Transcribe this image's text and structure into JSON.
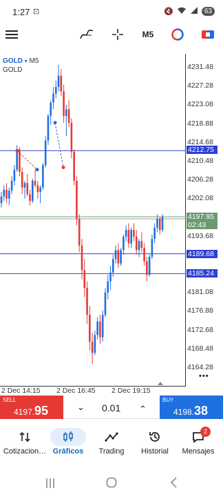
{
  "status": {
    "time": "1:27",
    "battery": "63"
  },
  "toolbar": {
    "timeframe": "M5"
  },
  "chart": {
    "symbol": "GOLD",
    "timeframe": "M5",
    "description": "GOLD",
    "price_ticks": [
      "4231.48",
      "4227.28",
      "4223.08",
      "4218.88",
      "4214.68",
      "4210.48",
      "4206.28",
      "4202.08",
      "4193.68",
      "4181.08",
      "4176.88",
      "4172.68",
      "4168.48",
      "4164.28"
    ],
    "levels": [
      {
        "price": "4212.75"
      },
      {
        "price": "4189.68"
      },
      {
        "price": "4185.24"
      }
    ],
    "current_price": "4197.95",
    "countdown": "02:43",
    "time_labels": [
      "2 Dec 14:15",
      "2 Dec 16:45",
      "2 Dec 19:15"
    ],
    "more": "•••"
  },
  "chart_data": {
    "type": "candlestick",
    "symbol": "GOLD",
    "timeframe": "M5",
    "ylim": [
      4162,
      4233
    ],
    "x_ticks": [
      "2 Dec 14:15",
      "2 Dec 16:45",
      "2 Dec 19:15"
    ],
    "y_ticks": [
      4231.48,
      4227.28,
      4223.08,
      4218.88,
      4214.68,
      4210.48,
      4206.28,
      4202.08,
      4193.68,
      4181.08,
      4176.88,
      4172.68,
      4168.48,
      4164.28
    ],
    "horizontal_levels": [
      4212.75,
      4189.68,
      4185.24
    ],
    "current_bid": 4197.95,
    "candles": [
      [
        4201.0,
        4203.5,
        4200.0,
        4202.5
      ],
      [
        4202.5,
        4205.0,
        4201.5,
        4204.0
      ],
      [
        4204.0,
        4205.5,
        4201.0,
        4202.0
      ],
      [
        4202.0,
        4204.5,
        4200.5,
        4203.8
      ],
      [
        4203.8,
        4207.0,
        4203.0,
        4206.0
      ],
      [
        4206.0,
        4209.5,
        4205.0,
        4208.5
      ],
      [
        4208.5,
        4214.0,
        4208.0,
        4213.0
      ],
      [
        4213.0,
        4213.5,
        4207.0,
        4208.0
      ],
      [
        4208.0,
        4209.0,
        4203.0,
        4204.5
      ],
      [
        4204.5,
        4206.0,
        4202.0,
        4205.5
      ],
      [
        4205.5,
        4207.5,
        4202.5,
        4203.0
      ],
      [
        4203.0,
        4204.0,
        4200.5,
        4201.5
      ],
      [
        4201.5,
        4206.5,
        4201.0,
        4206.0
      ],
      [
        4206.0,
        4208.5,
        4204.5,
        4205.0
      ],
      [
        4205.0,
        4206.0,
        4202.0,
        4203.5
      ],
      [
        4203.5,
        4205.0,
        4201.0,
        4204.5
      ],
      [
        4204.5,
        4210.0,
        4204.0,
        4209.5
      ],
      [
        4209.5,
        4216.0,
        4209.0,
        4215.0
      ],
      [
        4215.0,
        4221.0,
        4214.0,
        4220.5
      ],
      [
        4220.5,
        4224.0,
        4218.5,
        4223.5
      ],
      [
        4223.5,
        4227.0,
        4222.0,
        4225.5
      ],
      [
        4225.5,
        4228.5,
        4224.5,
        4227.0
      ],
      [
        4227.0,
        4232.0,
        4226.0,
        4229.5
      ],
      [
        4229.5,
        4231.0,
        4225.0,
        4226.0
      ],
      [
        4226.0,
        4227.5,
        4219.0,
        4220.5
      ],
      [
        4220.5,
        4223.0,
        4216.0,
        4222.0
      ],
      [
        4222.0,
        4224.0,
        4218.0,
        4219.0
      ],
      [
        4219.0,
        4220.0,
        4211.0,
        4212.5
      ],
      [
        4212.5,
        4213.0,
        4205.0,
        4206.0
      ],
      [
        4206.0,
        4207.0,
        4196.0,
        4197.5
      ],
      [
        4197.5,
        4198.5,
        4190.0,
        4191.5
      ],
      [
        4191.5,
        4193.0,
        4184.0,
        4186.0
      ],
      [
        4186.0,
        4188.5,
        4180.0,
        4182.0
      ],
      [
        4182.0,
        4183.5,
        4174.0,
        4176.0
      ],
      [
        4176.0,
        4178.0,
        4168.0,
        4170.0
      ],
      [
        4170.0,
        4172.0,
        4165.0,
        4167.5
      ],
      [
        4167.5,
        4172.5,
        4167.0,
        4171.5
      ],
      [
        4171.5,
        4175.5,
        4170.5,
        4174.5
      ],
      [
        4174.5,
        4176.0,
        4169.5,
        4171.0
      ],
      [
        4171.0,
        4177.0,
        4170.0,
        4176.0
      ],
      [
        4176.0,
        4182.0,
        4175.5,
        4181.0
      ],
      [
        4181.0,
        4185.0,
        4179.5,
        4183.5
      ],
      [
        4183.5,
        4187.0,
        4181.5,
        4185.5
      ],
      [
        4185.5,
        4189.5,
        4184.5,
        4188.5
      ],
      [
        4188.5,
        4191.5,
        4187.5,
        4190.5
      ],
      [
        4190.5,
        4192.0,
        4186.5,
        4187.5
      ],
      [
        4187.5,
        4191.0,
        4187.0,
        4190.5
      ],
      [
        4190.5,
        4194.0,
        4189.5,
        4193.5
      ],
      [
        4193.5,
        4196.0,
        4192.5,
        4195.0
      ],
      [
        4195.0,
        4196.5,
        4191.0,
        4192.0
      ],
      [
        4192.0,
        4195.5,
        4191.0,
        4195.0
      ],
      [
        4195.0,
        4196.5,
        4192.5,
        4193.5
      ],
      [
        4193.5,
        4195.0,
        4189.5,
        4190.5
      ],
      [
        4190.5,
        4193.0,
        4189.0,
        4192.5
      ],
      [
        4192.5,
        4194.5,
        4190.0,
        4191.0
      ],
      [
        4191.0,
        4192.0,
        4187.0,
        4188.0
      ],
      [
        4188.0,
        4189.0,
        4183.5,
        4185.0
      ],
      [
        4185.0,
        4189.5,
        4184.5,
        4189.0
      ],
      [
        4189.0,
        4194.0,
        4188.5,
        4193.0
      ],
      [
        4193.0,
        4196.5,
        4192.0,
        4195.5
      ],
      [
        4195.5,
        4198.5,
        4194.5,
        4197.5
      ],
      [
        4197.5,
        4198.0,
        4194.0,
        4195.0
      ],
      [
        4195.0,
        4198.5,
        4194.5,
        4197.95
      ]
    ]
  },
  "trade": {
    "sell_label": "SELL",
    "sell_price_small": "4197.",
    "sell_price_big": "95",
    "buy_label": "BUY",
    "buy_price_small": "4198.",
    "buy_price_big": "38",
    "lot": "0.01",
    "sell_color": "#e53935",
    "buy_color": "#1e6fe0"
  },
  "nav": [
    {
      "label": "Cotizacion…",
      "icon": "quotes-icon"
    },
    {
      "label": "Gráficos",
      "icon": "chart-icon"
    },
    {
      "label": "Trading",
      "icon": "trading-icon"
    },
    {
      "label": "Historial",
      "icon": "history-icon"
    },
    {
      "label": "Mensajes",
      "icon": "messages-icon",
      "badge": "2"
    }
  ]
}
